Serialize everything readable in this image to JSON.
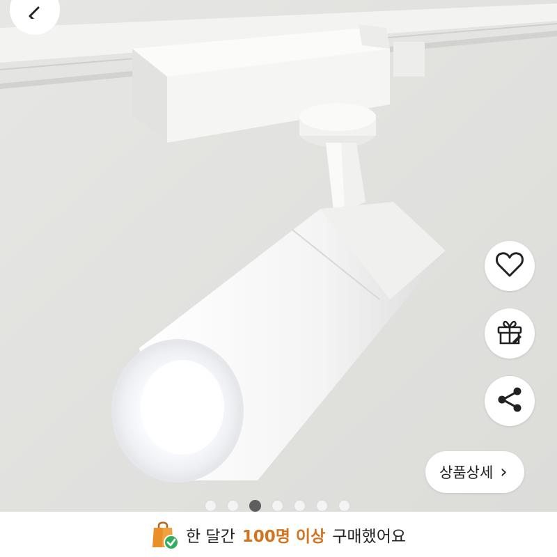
{
  "icons": {
    "back": "chevron-left-icon",
    "wishlist": "heart-icon",
    "gift": "gift-icon",
    "share": "share-icon",
    "detail_arrow": "chevron-right-icon",
    "banner": "shopping-bag-check-icon"
  },
  "product_image": {
    "carousel": {
      "total": 7,
      "active_index": 2
    }
  },
  "detail_button": {
    "label": "상품상세",
    "arrow": "›"
  },
  "banner": {
    "prefix": "한 달간",
    "highlight": "100명 이상",
    "suffix": "구매했어요"
  },
  "colors": {
    "highlight": "#d4731e",
    "active_dot": "#5e5e5e"
  }
}
